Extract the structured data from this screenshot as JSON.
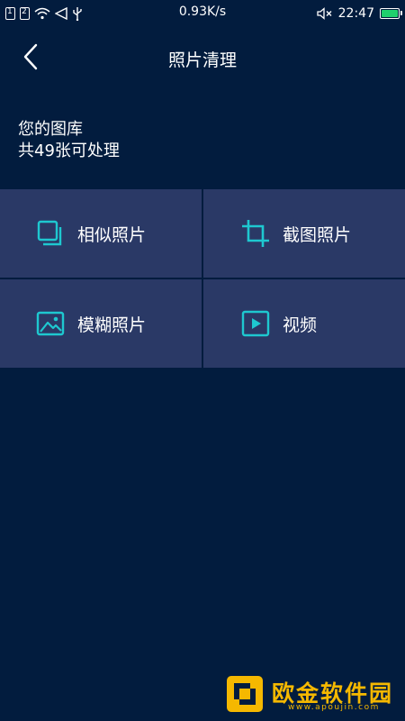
{
  "status_bar": {
    "sim1": "1",
    "sim2": "2",
    "network_speed": "0.93K/s",
    "time": "22:47",
    "icons": [
      "sim1-icon",
      "sim2-icon",
      "wifi-icon",
      "nav-icon",
      "usb-icon",
      "mute-icon",
      "battery-icon"
    ],
    "battery_color": "#1fd06d"
  },
  "header": {
    "title": "照片清理",
    "back_icon": "chevron-left-icon"
  },
  "summary": {
    "line1": "您的图库",
    "line2": "共49张可处理"
  },
  "categories": [
    {
      "label": "相似照片",
      "icon": "similar-photos-icon"
    },
    {
      "label": "截图照片",
      "icon": "crop-icon"
    },
    {
      "label": "模糊照片",
      "icon": "image-icon"
    },
    {
      "label": "视频",
      "icon": "video-icon"
    }
  ],
  "watermark": {
    "text": "欧金软件园",
    "url": "www.apoujin.com"
  },
  "colors": {
    "background": "#021c3e",
    "cell": "#2a3966",
    "accent": "#1ec8d0",
    "watermark": "#f5b800"
  }
}
